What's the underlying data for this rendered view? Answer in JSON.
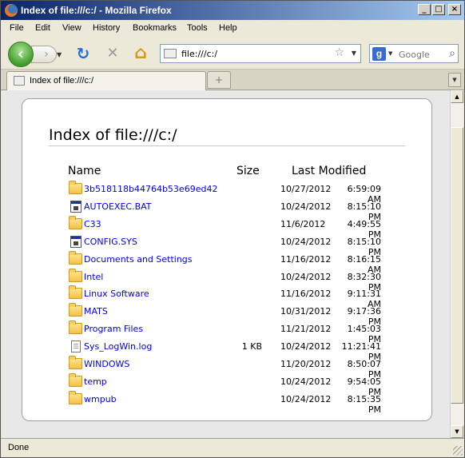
{
  "window": {
    "title": "Index of file:///c:/ - Mozilla Firefox",
    "minimize": "_",
    "maximize": "□",
    "close": "×"
  },
  "menu": {
    "file": "File",
    "edit": "Edit",
    "view": "View",
    "history": "History",
    "bookmarks": "Bookmarks",
    "tools": "Tools",
    "help": "Help"
  },
  "nav": {
    "back": "‹",
    "forward": "›",
    "reload": "↻",
    "stop": "✕",
    "home": "⌂",
    "url": "file:///c:/",
    "bookmark_star": "☆",
    "search_engine": "g",
    "search_placeholder": "Google",
    "search_icon": "⌕"
  },
  "tabs": {
    "active_label": "Index of file:///c:/",
    "new_tab": "+"
  },
  "page": {
    "heading": "Index of file:///c:/",
    "columns": {
      "name": "Name",
      "size": "Size",
      "modified": "Last Modified"
    },
    "entries": [
      {
        "name": "3b518118b44764b53e69ed42",
        "type": "folder",
        "size": "",
        "date": "10/27/2012",
        "time": "6:59:09 AM"
      },
      {
        "name": "AUTOEXEC.BAT",
        "type": "system-file",
        "size": "",
        "date": "10/24/2012",
        "time": "8:15:10 PM"
      },
      {
        "name": "C33",
        "type": "folder",
        "size": "",
        "date": "11/6/2012",
        "time": "4:49:55 PM"
      },
      {
        "name": "CONFIG.SYS",
        "type": "system-file",
        "size": "",
        "date": "10/24/2012",
        "time": "8:15:10 PM"
      },
      {
        "name": "Documents and Settings",
        "type": "folder",
        "size": "",
        "date": "11/16/2012",
        "time": "8:16:15 AM"
      },
      {
        "name": "Intel",
        "type": "folder",
        "size": "",
        "date": "10/24/2012",
        "time": "8:32:30 PM"
      },
      {
        "name": "Linux Software",
        "type": "folder",
        "size": "",
        "date": "11/16/2012",
        "time": "9:11:31 AM"
      },
      {
        "name": "MATS",
        "type": "folder",
        "size": "",
        "date": "10/31/2012",
        "time": "9:17:36 PM"
      },
      {
        "name": "Program Files",
        "type": "folder",
        "size": "",
        "date": "11/21/2012",
        "time": "1:45:03 PM"
      },
      {
        "name": "Sys_LogWin.log",
        "type": "text-file",
        "size": "1 KB",
        "date": "10/24/2012",
        "time": "11:21:41 PM"
      },
      {
        "name": "WINDOWS",
        "type": "folder",
        "size": "",
        "date": "11/20/2012",
        "time": "8:50:07 PM"
      },
      {
        "name": "temp",
        "type": "folder",
        "size": "",
        "date": "10/24/2012",
        "time": "9:54:05 PM"
      },
      {
        "name": "wmpub",
        "type": "folder",
        "size": "",
        "date": "10/24/2012",
        "time": "8:15:35 PM"
      }
    ]
  },
  "status": {
    "text": "Done"
  }
}
